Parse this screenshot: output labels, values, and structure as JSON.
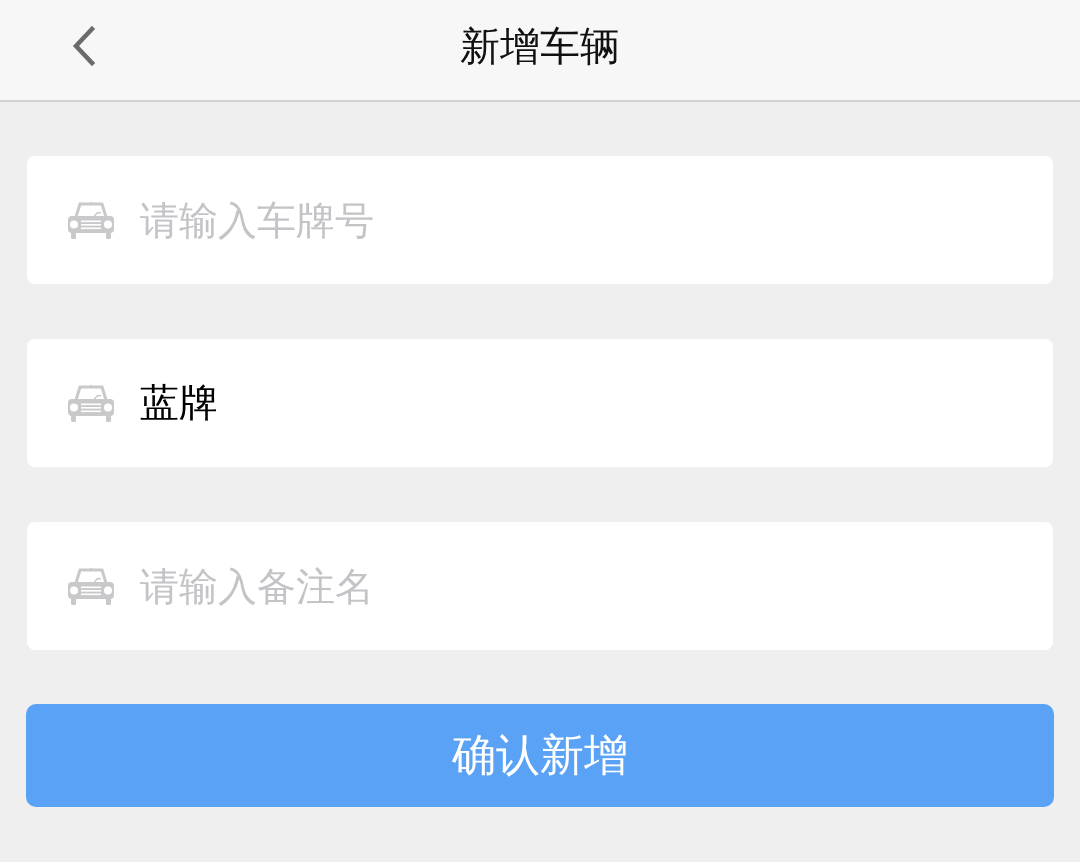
{
  "header": {
    "title": "新增车辆"
  },
  "fields": [
    {
      "placeholder": "请输入车牌号"
    },
    {
      "value": "蓝牌"
    },
    {
      "placeholder": "请输入备注名"
    }
  ],
  "submit_button": {
    "label": "确认新增"
  }
}
